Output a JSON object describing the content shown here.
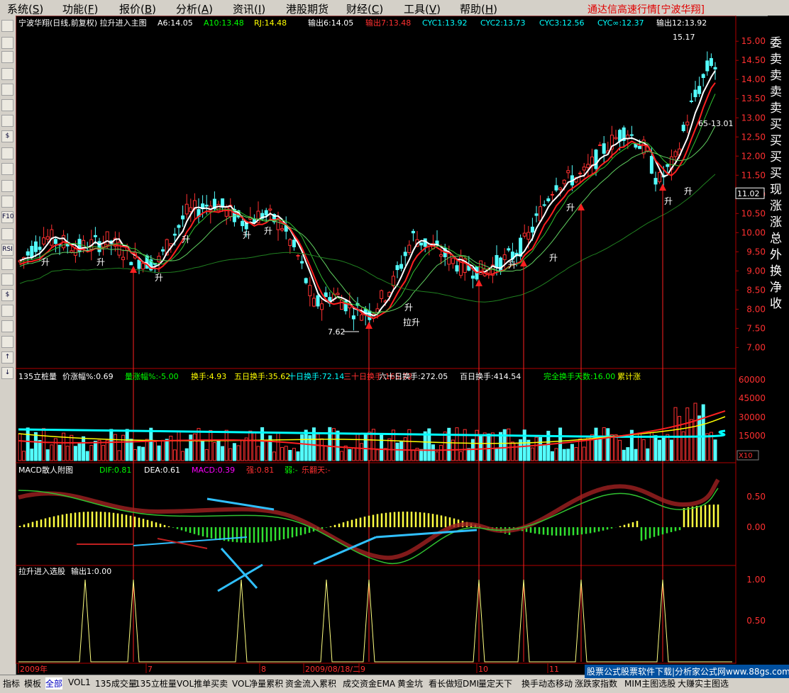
{
  "menu": [
    {
      "label": "系统",
      "key": "S"
    },
    {
      "label": "功能",
      "key": "F"
    },
    {
      "label": "报价",
      "key": "B"
    },
    {
      "label": "分析",
      "key": "A"
    },
    {
      "label": "资讯",
      "key": "I"
    },
    {
      "label": "港股期货",
      "key": ""
    },
    {
      "label": "财经",
      "key": "C"
    },
    {
      "label": "工具",
      "key": "V"
    },
    {
      "label": "帮助",
      "key": "H"
    }
  ],
  "app_banner": "通达信高速行情[宁波华翔]",
  "toolbar_icons": [
    "chart-icon",
    "bars-icon",
    "trend-icon",
    "candle-icon",
    "window-icon",
    "grid-icon",
    "table-icon",
    "dollar-icon",
    "mail-icon",
    "people-icon",
    "ftp-icon",
    "zoom-icon",
    "f10-icon",
    "line-icon",
    "rsi-icon",
    "compare-icon",
    "window2-icon",
    "money-icon",
    "wrench-icon",
    "export-icon",
    "pen-icon",
    "arrow-up-icon",
    "arrow-down-icon"
  ],
  "toolbar_labels": [
    "",
    "",
    "",
    "",
    "",
    "",
    "",
    "$",
    "",
    "",
    "",
    "",
    "F10",
    "",
    "RSI",
    "",
    "",
    "$",
    "",
    "",
    "",
    "↑",
    "↓"
  ],
  "main_panel": {
    "title": "宁波华翔(日线,前复权) 拉升进入主图",
    "indicators": [
      {
        "label": "A6:14.05",
        "color": "#ffffff"
      },
      {
        "label": "A10:13.48",
        "color": "#00ff00"
      },
      {
        "label": "RJ:14.48",
        "color": "#ffff00"
      },
      {
        "label": "输出6:14.05",
        "color": "#ffffff"
      },
      {
        "label": "输出7:13.48",
        "color": "#ff3030"
      },
      {
        "label": "CYC1:13.92",
        "color": "#00ffff"
      },
      {
        "label": "CYC2:13.73",
        "color": "#00ffff"
      },
      {
        "label": "CYC3:12.56",
        "color": "#00ffff"
      },
      {
        "label": "CYC∞:12.37",
        "color": "#00ffff"
      },
      {
        "label": "输出12:13.92",
        "color": "#ffffff"
      }
    ],
    "price_axis": [
      "15.00",
      "14.50",
      "14.00",
      "13.50",
      "13.00",
      "12.50",
      "12.00",
      "11.50",
      "11.00",
      "10.50",
      "10.00",
      "9.50",
      "9.00",
      "8.50",
      "8.00",
      "7.50",
      "7.00"
    ],
    "current_price": "11.02",
    "high_label": "15.17",
    "low_label": "7.62",
    "range_label": "65-13.01",
    "rise_label": "升",
    "pull_rise_label": "拉升"
  },
  "vol_panel": {
    "title": "135立桩量",
    "indicators": [
      {
        "label": "价涨幅%:0.69",
        "color": "#ffffff"
      },
      {
        "label": "量涨幅%:-5.00",
        "color": "#00ff00"
      },
      {
        "label": "换手:4.93",
        "color": "#ffff00"
      },
      {
        "label": "五日换手:35.62",
        "color": "#ffff00"
      },
      {
        "label": "十日换手:72.14",
        "color": "#00ffff"
      },
      {
        "label": "三十日换手:165.72",
        "color": "#ff3030"
      },
      {
        "label": "六十日换手:272.05",
        "color": "#ffffff"
      },
      {
        "label": "百日换手:414.54",
        "color": "#ffffff"
      },
      {
        "label": "完全换手天数:16.00",
        "color": "#00ff00"
      },
      {
        "label": "累计涨",
        "color": "#ffff00"
      }
    ],
    "axis": [
      "60000",
      "45000",
      "30000",
      "15000"
    ],
    "unit_label": "X10"
  },
  "macd_panel": {
    "title": "MACD散人附图",
    "indicators": [
      {
        "label": "DIF:0.81",
        "color": "#00ff00"
      },
      {
        "label": "DEA:0.61",
        "color": "#ffffff"
      },
      {
        "label": "MACD:0.39",
        "color": "#ff00ff"
      },
      {
        "label": "强:0.81",
        "color": "#ff3030"
      },
      {
        "label": "弱:-",
        "color": "#00ff00"
      },
      {
        "label": "乐翻天:-",
        "color": "#ff3030"
      }
    ],
    "axis": [
      "0.50",
      "0.00"
    ]
  },
  "signal_panel": {
    "title": "拉升进入选股",
    "indicators": [
      {
        "label": "输出1:0.00",
        "color": "#ffffff"
      }
    ],
    "axis": [
      "1.00",
      "0.50"
    ]
  },
  "date_axis": {
    "labels": [
      "2009年",
      "7",
      "8",
      "2009/08/18/二",
      "9",
      "10",
      "11"
    ]
  },
  "right_info": [
    "委",
    "卖",
    "卖",
    "卖",
    "卖",
    "买",
    "买",
    "买",
    "买",
    "现",
    "涨",
    "涨",
    "总",
    "外",
    "换",
    "净",
    "收"
  ],
  "bottom_tabs": [
    "指标",
    "模板",
    "全部",
    "VOL1",
    "135成交量",
    "135立桩量",
    "VOL推单买卖",
    "VOL净量累积",
    "资金流入累积",
    "成交资金EMA",
    "黄金坑",
    "看长做短DMI",
    "量定天下",
    "换手动态移动",
    "涨跌家指数",
    "MIM主图选股",
    "大赚实主图选"
  ],
  "active_tab": 2,
  "watermark": "股票公式股票软件下载|分析家公式网www.88gs.com"
}
